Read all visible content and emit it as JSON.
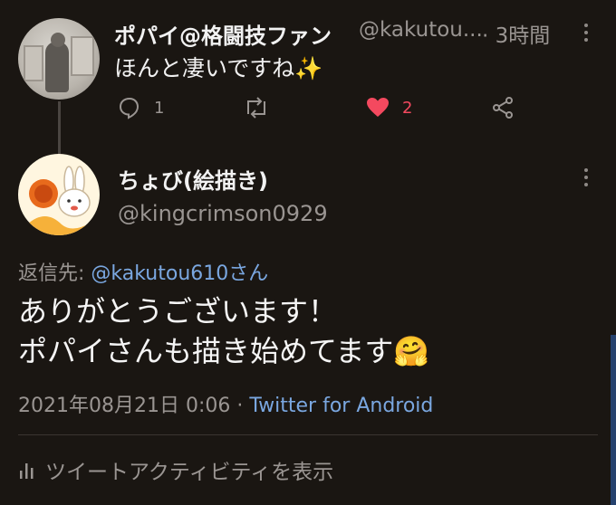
{
  "tweet1": {
    "name": "ポパイ@格闘技ファン",
    "handle": "@kakutou...",
    "time": "· 3時間",
    "text": "ほんと凄いですね✨",
    "reply_count": "1",
    "like_count": "2"
  },
  "tweet2": {
    "name": "ちょび(絵描き)",
    "handle": "@kingcrimson0929",
    "reply_prefix": "返信先: ",
    "reply_mention": "@kakutou610さん",
    "body_line1": "ありがとうございます！",
    "body_line2": "ポパイさんも描き始めてます🤗",
    "datetime": "2021年08月21日 0:06 · ",
    "source": "Twitter for Android",
    "activity_label": "ツイートアクティビティを表示"
  },
  "colors": {
    "background": "#1a1612",
    "link": "#7aa7e0",
    "like": "#f4495f",
    "muted": "#9a9592"
  },
  "icons": [
    "reply-icon",
    "retweet-icon",
    "heart-icon",
    "share-icon",
    "more-icon",
    "activity-icon"
  ]
}
